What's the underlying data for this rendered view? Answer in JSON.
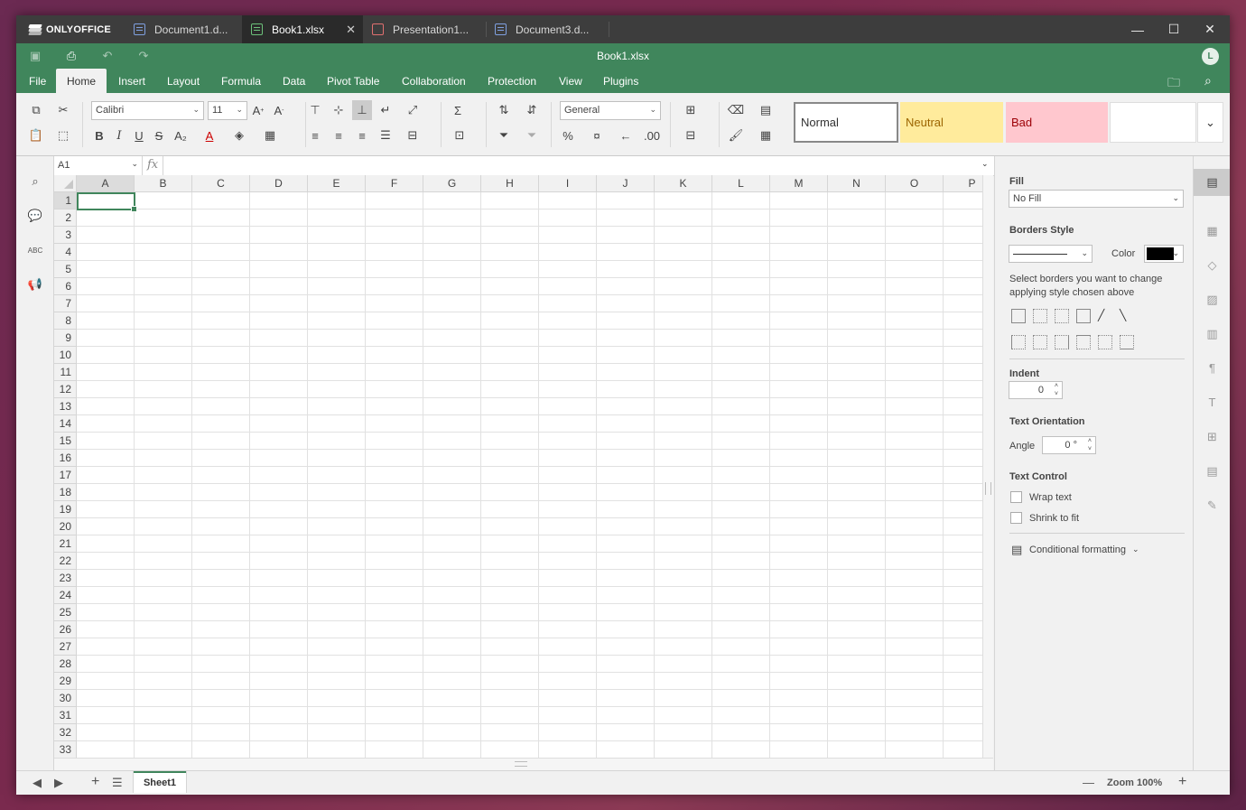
{
  "app": {
    "logo": "ONLYOFFICE"
  },
  "tabs": [
    {
      "label": "Document1.d...",
      "type": "doc"
    },
    {
      "label": "Book1.xlsx",
      "type": "xls",
      "active": true
    },
    {
      "label": "Presentation1...",
      "type": "ppt"
    },
    {
      "label": "Document3.d...",
      "type": "doc"
    }
  ],
  "window_controls": {
    "minimize": "—",
    "maximize": "☐",
    "close": "✕"
  },
  "header": {
    "title": "Book1.xlsx",
    "avatar": "L"
  },
  "menu": {
    "file": "File",
    "home": "Home",
    "insert": "Insert",
    "layout": "Layout",
    "formula": "Formula",
    "data": "Data",
    "pivot": "Pivot Table",
    "collab": "Collaboration",
    "protection": "Protection",
    "view": "View",
    "plugins": "Plugins"
  },
  "toolbar": {
    "font_name": "Calibri",
    "font_size": "11",
    "number_format": "General",
    "styles": {
      "normal": "Normal",
      "neutral": "Neutral",
      "bad": "Bad"
    },
    "colors": {
      "neutral_bg": "#ffeb9c",
      "bad_bg": "#ffc7ce",
      "neutral_fg": "#9c6500",
      "bad_fg": "#9c0006"
    }
  },
  "formula_bar": {
    "cell_ref": "A1",
    "fx": "fx",
    "value": ""
  },
  "grid": {
    "columns": [
      "A",
      "B",
      "C",
      "D",
      "E",
      "F",
      "G",
      "H",
      "I",
      "J",
      "K",
      "L",
      "M",
      "N",
      "O",
      "P"
    ],
    "rows": [
      "1",
      "2",
      "3",
      "4",
      "5",
      "6",
      "7",
      "8",
      "9",
      "10",
      "11",
      "12",
      "13",
      "14",
      "15",
      "16",
      "17",
      "18",
      "19",
      "20",
      "21",
      "22",
      "23",
      "24",
      "25",
      "26",
      "27",
      "28",
      "29",
      "30",
      "31",
      "32",
      "33"
    ]
  },
  "panel": {
    "fill_label": "Fill",
    "fill_value": "No Fill",
    "borders_label": "Borders Style",
    "color_label": "Color",
    "borders_hint": "Select borders you want to change applying style chosen above",
    "indent_label": "Indent",
    "indent_value": "0",
    "orientation_label": "Text Orientation",
    "angle_label": "Angle",
    "angle_value": "0 °",
    "text_control_label": "Text Control",
    "wrap_text": "Wrap text",
    "shrink_fit": "Shrink to fit",
    "cond_format": "Conditional formatting"
  },
  "status": {
    "sheet": "Sheet1",
    "zoom": "Zoom 100%"
  }
}
